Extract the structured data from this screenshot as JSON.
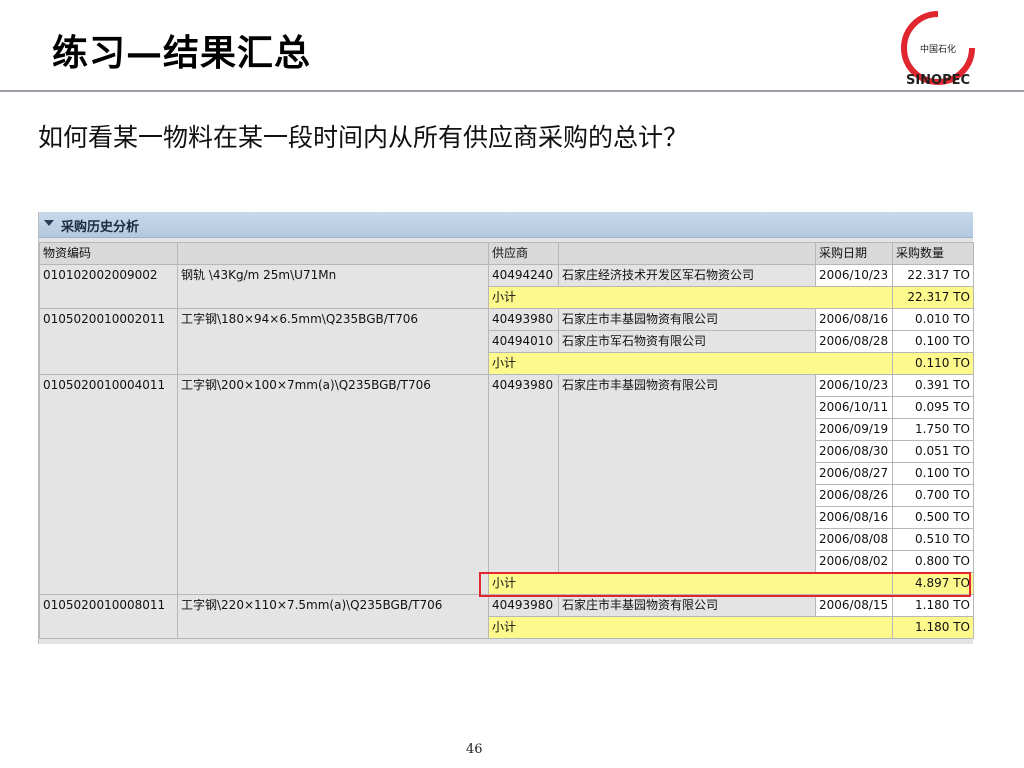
{
  "slide": {
    "title": "练习—结果汇总",
    "question": "如何看某一物料在某一段时间内从所有供应商采购的总计？",
    "page_number": "46"
  },
  "logo": {
    "text_top": "中国石化",
    "text_bottom": "SINOPEC",
    "color": "#e0262e"
  },
  "panel": {
    "title": "采购历史分析",
    "headers": [
      "物资编码",
      "",
      "供应商",
      "",
      "采购日期",
      "采购数量"
    ]
  },
  "groups": [
    {
      "code": "010102002009002",
      "desc": "钢轨 \\43Kg/m 25m\\U71Mn",
      "vendors": [
        {
          "id": "40494240",
          "name": "石家庄经济技术开发区军石物资公司",
          "rows": [
            {
              "date": "2006/10/23",
              "qty": "22.317 TO"
            }
          ]
        }
      ],
      "subtotal_label": "小计",
      "subtotal": "22.317 TO"
    },
    {
      "code": "0105020010002011",
      "desc": "工字钢\\180×94×6.5mm\\Q235BGB/T706",
      "vendors": [
        {
          "id": "40493980",
          "name": "石家庄市丰基园物资有限公司",
          "rows": [
            {
              "date": "2006/08/16",
              "qty": "0.010 TO"
            }
          ]
        },
        {
          "id": "40494010",
          "name": "石家庄市军石物资有限公司",
          "rows": [
            {
              "date": "2006/08/28",
              "qty": "0.100 TO"
            }
          ]
        }
      ],
      "subtotal_label": "小计",
      "subtotal": "0.110 TO"
    },
    {
      "code": "0105020010004011",
      "desc": "工字钢\\200×100×7mm(a)\\Q235BGB/T706",
      "vendors": [
        {
          "id": "40493980",
          "name": "石家庄市丰基园物资有限公司",
          "rows": [
            {
              "date": "2006/10/23",
              "qty": "0.391 TO"
            },
            {
              "date": "2006/10/11",
              "qty": "0.095 TO"
            },
            {
              "date": "2006/09/19",
              "qty": "1.750 TO"
            },
            {
              "date": "2006/08/30",
              "qty": "0.051 TO"
            },
            {
              "date": "2006/08/27",
              "qty": "0.100 TO"
            },
            {
              "date": "2006/08/26",
              "qty": "0.700 TO"
            },
            {
              "date": "2006/08/16",
              "qty": "0.500 TO"
            },
            {
              "date": "2006/08/08",
              "qty": "0.510 TO"
            },
            {
              "date": "2006/08/02",
              "qty": "0.800 TO"
            }
          ]
        }
      ],
      "subtotal_label": "小计",
      "subtotal": "4.897 TO"
    },
    {
      "code": "0105020010008011",
      "desc": "工字钢\\220×110×7.5mm(a)\\Q235BGB/T706",
      "vendors": [
        {
          "id": "40493980",
          "name": "石家庄市丰基园物资有限公司",
          "rows": [
            {
              "date": "2006/08/15",
              "qty": "1.180 TO"
            }
          ]
        }
      ],
      "subtotal_label": "小计",
      "subtotal": "1.180 TO"
    }
  ]
}
